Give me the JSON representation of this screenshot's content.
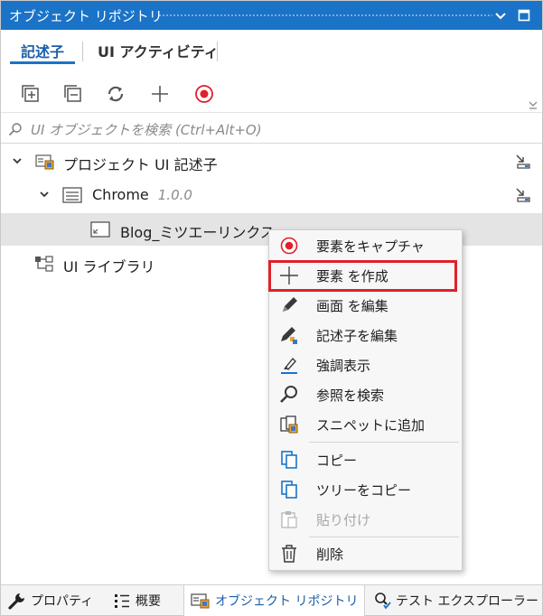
{
  "panel": {
    "title": "オブジェクト リポジトリ"
  },
  "tabs": [
    {
      "label": "記述子",
      "active": true
    },
    {
      "label": "UI アクティビティ",
      "active": false
    }
  ],
  "toolbar": {
    "icons": [
      "expand-all-icon",
      "collapse-all-icon",
      "refresh-icon",
      "add-icon",
      "record-icon"
    ]
  },
  "search": {
    "placeholder": "UI オブジェクトを検索 (Ctrl+Alt+O)"
  },
  "tree": {
    "project": {
      "label": "プロジェクト UI 記述子"
    },
    "app": {
      "label": "Chrome",
      "version": "1.0.0"
    },
    "screen": {
      "label": "Blog_ミツエーリンクス"
    },
    "library": {
      "label": "UI ライブラリ"
    }
  },
  "context_menu": {
    "items": [
      {
        "label": "要素をキャプチャ",
        "icon": "capture-icon"
      },
      {
        "label": "要素 を作成",
        "icon": "plus-icon"
      },
      {
        "label": "画面 を編集",
        "icon": "pencil-icon"
      },
      {
        "label": "記述子を編集",
        "icon": "pencil-color-icon"
      },
      {
        "label": "強調表示",
        "icon": "highlight-icon"
      },
      {
        "label": "参照を検索",
        "icon": "search-icon"
      },
      {
        "label": "スニペットに追加",
        "icon": "snippet-icon"
      },
      {
        "label": "コピー",
        "icon": "copy-icon"
      },
      {
        "label": "ツリーをコピー",
        "icon": "copy-tree-icon"
      },
      {
        "label": "貼り付け",
        "icon": "paste-icon",
        "disabled": true
      },
      {
        "label": "削除",
        "icon": "trash-icon"
      }
    ]
  },
  "bottom_tabs": [
    {
      "label": "プロパティ",
      "icon": "wrench-icon"
    },
    {
      "label": "概要",
      "icon": "outline-icon"
    },
    {
      "label": "オブジェクト リポジトリ",
      "icon": "repository-icon",
      "active": true
    },
    {
      "label": "テスト エクスプローラー",
      "icon": "test-explorer-icon"
    }
  ],
  "colors": {
    "accent": "#1a73c7",
    "record_red": "#e0202a",
    "highlight_border": "#e0202a"
  }
}
